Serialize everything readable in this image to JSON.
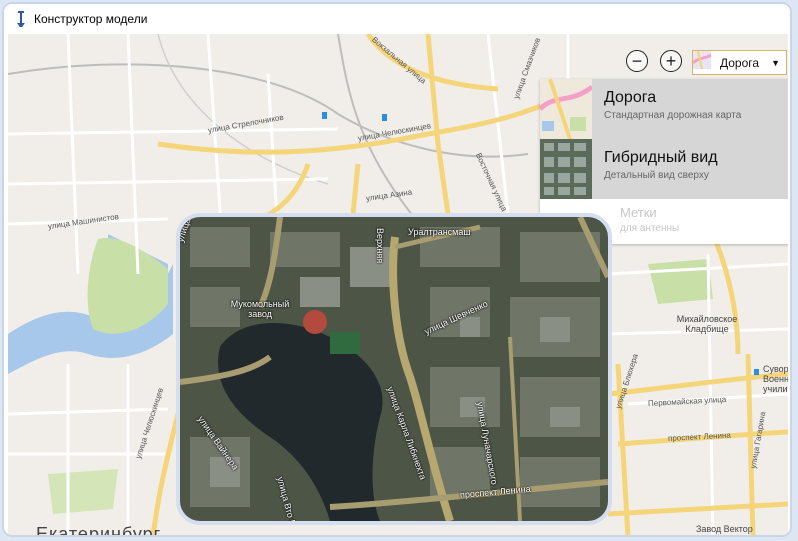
{
  "window": {
    "title": "Конструктор модели"
  },
  "map": {
    "labels": {
      "strelochnikov": "улица Стрелочников",
      "chelyuskintsev": "улица Челюскинцев",
      "azina": "улица Азина",
      "mashinistov": "улица Машинистов",
      "vokzalnaya": "Вокзальная улица",
      "vostochnaya": "Восточная улица",
      "smazchikov": "улица Смазчиков",
      "chelyuskintsev2": "улица Челюскинцев",
      "mikhailovskoe": "Михайловское Кладбище",
      "pervomayskaya": "Первомайская улица",
      "lenina": "проспект Ленина",
      "blyukhera": "улица Блюхера",
      "suvorov": "Суворов Военн училищ",
      "gagarina": "улица Гагарина",
      "vector": "Завод Вектор",
      "city": "Екатеринбург"
    }
  },
  "controls": {
    "zoom_out_label": "−",
    "zoom_in_label": "+",
    "map_type_value": "Дорога"
  },
  "dropdown": {
    "options": [
      {
        "name": "Дорога",
        "desc": "Стандартная дорожная карта",
        "selected": true
      },
      {
        "name": "Гибридный вид",
        "desc": "Детальный вид сверху",
        "selected": false
      },
      {
        "name": "Метки",
        "desc": "для антенны",
        "disabled": true
      }
    ]
  },
  "preview": {
    "labels": {
      "uraltransmash": "Уралтрансмаш",
      "verkhnyaya": "Верхняя",
      "mukomolny": "Мукомольный завод",
      "shevchenko": "улица Шевченко",
      "karla_libknekhta": "улица Карла Либкнехта",
      "lunacharskogo": "улица Луначарского",
      "lenina": "проспект Ленина",
      "vto": "улица Вто Марта",
      "vaynera": "улица Вайнера",
      "chelyuskintsev": "улица Челюскинцев"
    }
  },
  "colors": {
    "road": "#f5d57a",
    "map_bg": "#f1eee9",
    "water": "#a7c8ea",
    "park": "#c9dfa8",
    "selected": "#d6d6d6"
  }
}
